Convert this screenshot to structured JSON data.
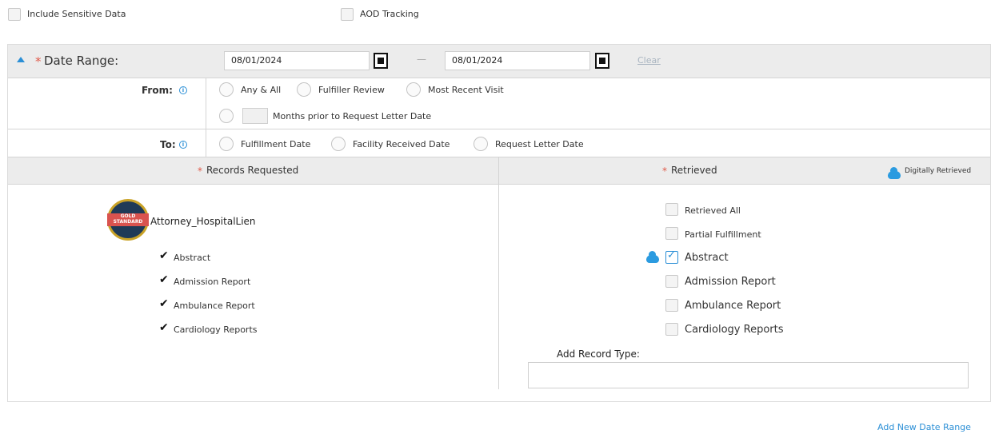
{
  "top_options": {
    "include_sensitive_label": "Include Sensitive Data",
    "aod_tracking_label": "AOD Tracking"
  },
  "date_range": {
    "required_mark": "*",
    "title": "Date Range:",
    "start_date": "08/01/2024",
    "separator": "—",
    "end_date": "08/01/2024",
    "clear_label": "Clear"
  },
  "from": {
    "label": "From:",
    "options": [
      "Any & All",
      "Fulfiller Review",
      "Most Recent Visit"
    ],
    "months_label": "Months prior to Request Letter Date",
    "months_value": ""
  },
  "to": {
    "label": "To:",
    "options": [
      "Fulfillment Date",
      "Facility Received Date",
      "Request Letter Date"
    ]
  },
  "records_requested": {
    "required_mark": "*",
    "title": "Records Requested",
    "badge_text": "GOLD STANDARD",
    "template_name": "Attorney_HospitalLien",
    "items": [
      "Abstract",
      "Admission Report",
      "Ambulance Report",
      "Cardiology Reports"
    ]
  },
  "retrieved": {
    "required_mark": "*",
    "title": "Retrieved",
    "digitally_retrieved_label": "Digitally Retrieved",
    "retrieved_all_label": "Retrieved All",
    "partial_label": "Partial Fulfillment",
    "items": [
      {
        "label": "Abstract",
        "checked": true,
        "digital": true
      },
      {
        "label": "Admission Report",
        "checked": false,
        "digital": false
      },
      {
        "label": "Ambulance Report",
        "checked": false,
        "digital": false
      },
      {
        "label": "Cardiology Reports",
        "checked": false,
        "digital": false
      }
    ],
    "add_record_type_label": "Add Record Type:",
    "add_record_type_value": ""
  },
  "footer": {
    "add_new_date_range": "Add New Date Range"
  },
  "colors": {
    "accent_blue": "#2b8fd6",
    "required_red": "#e05a4a",
    "header_gray": "#ececec"
  }
}
